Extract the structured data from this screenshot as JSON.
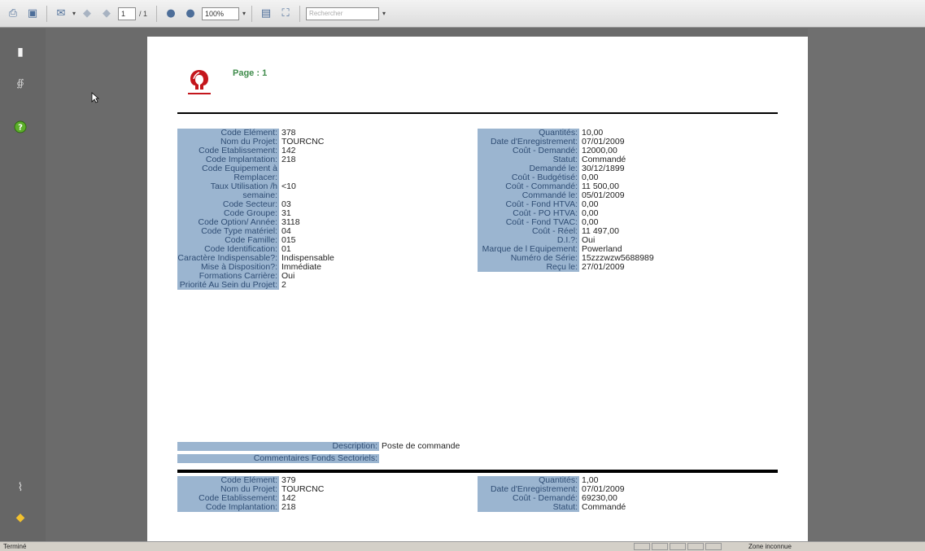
{
  "toolbar": {
    "page_current": "1",
    "page_total": "/ 1",
    "zoom": "100%",
    "search_placeholder": "Rechercher"
  },
  "page": {
    "label": "Page : 1"
  },
  "records": [
    {
      "left": [
        {
          "label": "Code Elément:",
          "value": "378"
        },
        {
          "label": "Nom du Projet:",
          "value": "TOURCNC"
        },
        {
          "label": "Code Etablissement:",
          "value": "142"
        },
        {
          "label": "Code Implantation:",
          "value": "218"
        },
        {
          "label": "Code Equipement à Remplacer:",
          "value": ""
        },
        {
          "label": "Taux Utilisation /h semaine:",
          "value": "<10"
        },
        {
          "label": "Code Secteur:",
          "value": "03"
        },
        {
          "label": "Code Groupe:",
          "value": "31"
        },
        {
          "label": "Code Option/ Année:",
          "value": "3118"
        },
        {
          "label": "Code Type matériel:",
          "value": "04"
        },
        {
          "label": "Code Famille:",
          "value": "015"
        },
        {
          "label": "Code Identification:",
          "value": "01"
        },
        {
          "label": "Caractère Indispensable?:",
          "value": "Indispensable"
        },
        {
          "label": "Mise à Disposition?:",
          "value": "Immédiate"
        },
        {
          "label": "Formations Carrière:",
          "value": "Oui"
        },
        {
          "label": "Priorité Au Sein du Projet:",
          "value": "2"
        }
      ],
      "right": [
        {
          "label": "Quantités:",
          "value": "10,00"
        },
        {
          "label": "Date d'Enregistrement:",
          "value": "07/01/2009"
        },
        {
          "label": "Coût - Demandé:",
          "value": "12000,00"
        },
        {
          "label": "Statut:",
          "value": "Commandé"
        },
        {
          "label": "Demandé le:",
          "value": "30/12/1899"
        },
        {
          "label": "Coût - Budgétisé:",
          "value": "0,00"
        },
        {
          "label": "Coût - Commandé:",
          "value": "11 500,00"
        },
        {
          "label": "Commandé le:",
          "value": "05/01/2009"
        },
        {
          "label": "Coût - Fond HTVA:",
          "value": "0,00"
        },
        {
          "label": "Coût - PO HTVA:",
          "value": "0,00"
        },
        {
          "label": "Coût - Fond TVAC:",
          "value": "0,00"
        },
        {
          "label": "Coût - Réel:",
          "value": "11 497,00"
        },
        {
          "label": "D.I.?:",
          "value": "Oui"
        },
        {
          "label": "Marque de l Equipement:",
          "value": "Powerland"
        },
        {
          "label": "Numéro de Série:",
          "value": "15zzzwzw5688989"
        },
        {
          "label": "Reçu le:",
          "value": "27/01/2009"
        }
      ],
      "description_label": "Description:",
      "description_value": "Poste de commande",
      "comments_label": "Commentaires Fonds Sectoriels:"
    },
    {
      "left": [
        {
          "label": "Code Elément:",
          "value": "379"
        },
        {
          "label": "Nom du Projet:",
          "value": "TOURCNC"
        },
        {
          "label": "Code Etablissement:",
          "value": "142"
        },
        {
          "label": "Code Implantation:",
          "value": "218"
        }
      ],
      "right": [
        {
          "label": "Quantités:",
          "value": "1,00"
        },
        {
          "label": "Date d'Enregistrement:",
          "value": "07/01/2009"
        },
        {
          "label": "Coût - Demandé:",
          "value": "69230,00"
        },
        {
          "label": "Statut:",
          "value": "Commandé"
        }
      ]
    }
  ],
  "status": {
    "left_text": "Terminé",
    "zone": "Zone inconnue"
  },
  "colors": {
    "label_bg": "#9bb5d0",
    "label_text": "#2f4d74",
    "page_label": "#3e8b4a",
    "logo": "#c4161c"
  }
}
